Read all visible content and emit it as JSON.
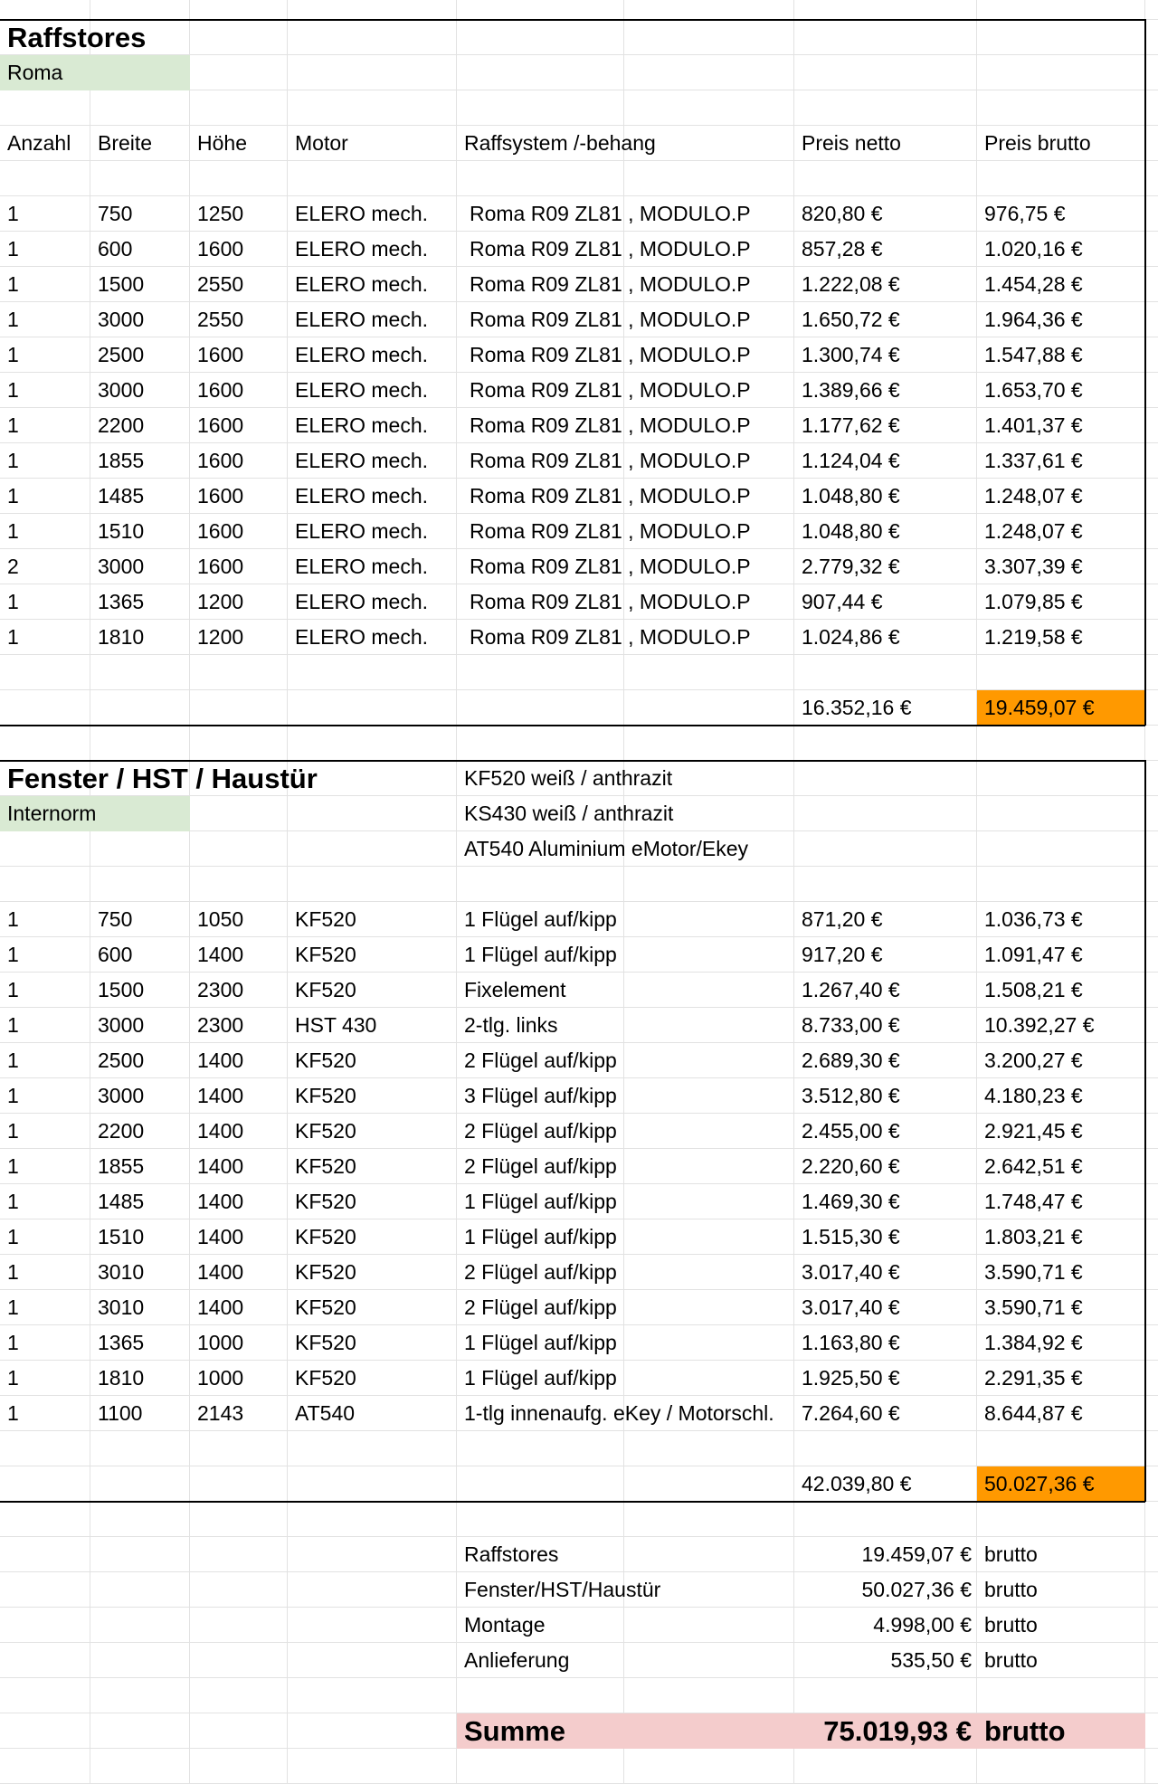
{
  "raff": {
    "title": "Raffstores",
    "subtitle": "Roma",
    "headers": [
      "Anzahl",
      "Breite",
      "Höhe",
      "Motor",
      "Raffsystem /-behang",
      "Preis netto",
      "Preis brutto"
    ],
    "rows": [
      [
        "1",
        "750",
        "1250",
        "ELERO mech.",
        "Roma R09 ZL81 , MODULO.P",
        "820,80 €",
        "976,75 €"
      ],
      [
        "1",
        "600",
        "1600",
        "ELERO mech.",
        "Roma R09 ZL81 , MODULO.P",
        "857,28 €",
        "1.020,16 €"
      ],
      [
        "1",
        "1500",
        "2550",
        "ELERO mech.",
        "Roma R09 ZL81 , MODULO.P",
        "1.222,08 €",
        "1.454,28 €"
      ],
      [
        "1",
        "3000",
        "2550",
        "ELERO mech.",
        "Roma R09 ZL81 , MODULO.P",
        "1.650,72 €",
        "1.964,36 €"
      ],
      [
        "1",
        "2500",
        "1600",
        "ELERO mech.",
        "Roma R09 ZL81 , MODULO.P",
        "1.300,74 €",
        "1.547,88 €"
      ],
      [
        "1",
        "3000",
        "1600",
        "ELERO mech.",
        "Roma R09 ZL81 , MODULO.P",
        "1.389,66 €",
        "1.653,70 €"
      ],
      [
        "1",
        "2200",
        "1600",
        "ELERO mech.",
        "Roma R09 ZL81 , MODULO.P",
        "1.177,62 €",
        "1.401,37 €"
      ],
      [
        "1",
        "1855",
        "1600",
        "ELERO mech.",
        "Roma R09 ZL81 , MODULO.P",
        "1.124,04 €",
        "1.337,61 €"
      ],
      [
        "1",
        "1485",
        "1600",
        "ELERO mech.",
        "Roma R09 ZL81 , MODULO.P",
        "1.048,80 €",
        "1.248,07 €"
      ],
      [
        "1",
        "1510",
        "1600",
        "ELERO mech.",
        "Roma R09 ZL81 , MODULO.P",
        "1.048,80 €",
        "1.248,07 €"
      ],
      [
        "2",
        "3000",
        "1600",
        "ELERO mech.",
        "Roma R09 ZL81 , MODULO.P",
        "2.779,32 €",
        "3.307,39 €"
      ],
      [
        "1",
        "1365",
        "1200",
        "ELERO mech.",
        "Roma R09 ZL81 , MODULO.P",
        "907,44 €",
        "1.079,85 €"
      ],
      [
        "1",
        "1810",
        "1200",
        "ELERO mech.",
        "Roma R09 ZL81 , MODULO.P",
        "1.024,86 €",
        "1.219,58 €"
      ]
    ],
    "total_netto": "16.352,16 €",
    "total_brutto": "19.459,07 €"
  },
  "fenster": {
    "title": "Fenster / HST / Haustür",
    "subtitle": "Internorm",
    "notes": [
      "KF520 weiß / anthrazit",
      "KS430 weiß / anthrazit",
      "AT540 Aluminium eMotor/Ekey"
    ],
    "rows": [
      [
        "1",
        "750",
        "1050",
        "KF520",
        "1 Flügel auf/kipp",
        "871,20 €",
        "1.036,73 €"
      ],
      [
        "1",
        "600",
        "1400",
        "KF520",
        "1 Flügel auf/kipp",
        "917,20 €",
        "1.091,47 €"
      ],
      [
        "1",
        "1500",
        "2300",
        "KF520",
        "Fixelement",
        "1.267,40 €",
        "1.508,21 €"
      ],
      [
        "1",
        "3000",
        "2300",
        "HST 430",
        "2-tlg. links",
        "8.733,00 €",
        "10.392,27 €"
      ],
      [
        "1",
        "2500",
        "1400",
        "KF520",
        "2 Flügel auf/kipp",
        "2.689,30 €",
        "3.200,27 €"
      ],
      [
        "1",
        "3000",
        "1400",
        "KF520",
        "3 Flügel auf/kipp",
        "3.512,80 €",
        "4.180,23 €"
      ],
      [
        "1",
        "2200",
        "1400",
        "KF520",
        "2 Flügel auf/kipp",
        "2.455,00 €",
        "2.921,45 €"
      ],
      [
        "1",
        "1855",
        "1400",
        "KF520",
        "2 Flügel auf/kipp",
        "2.220,60 €",
        "2.642,51 €"
      ],
      [
        "1",
        "1485",
        "1400",
        "KF520",
        "1 Flügel auf/kipp",
        "1.469,30 €",
        "1.748,47 €"
      ],
      [
        "1",
        "1510",
        "1400",
        "KF520",
        "1 Flügel auf/kipp",
        "1.515,30 €",
        "1.803,21 €"
      ],
      [
        "1",
        "3010",
        "1400",
        "KF520",
        "2 Flügel auf/kipp",
        "3.017,40 €",
        "3.590,71 €"
      ],
      [
        "1",
        "3010",
        "1400",
        "KF520",
        "2 Flügel auf/kipp",
        "3.017,40 €",
        "3.590,71 €"
      ],
      [
        "1",
        "1365",
        "1000",
        "KF520",
        "1 Flügel auf/kipp",
        "1.163,80 €",
        "1.384,92 €"
      ],
      [
        "1",
        "1810",
        "1000",
        "KF520",
        "1 Flügel auf/kipp",
        "1.925,50 €",
        "2.291,35 €"
      ],
      [
        "1",
        "1100",
        "2143",
        "AT540",
        "1-tlg innenaufg. eKey / Motorschl.",
        "7.264,60 €",
        "8.644,87 €"
      ]
    ],
    "total_netto": "42.039,80 €",
    "total_brutto": "50.027,36 €"
  },
  "summary": {
    "items": [
      {
        "label": "Raffstores",
        "value": "19.459,07 €",
        "unit": "brutto"
      },
      {
        "label": "Fenster/HST/Haustür",
        "value": "50.027,36 €",
        "unit": "brutto"
      },
      {
        "label": "Montage",
        "value": "4.998,00 €",
        "unit": "brutto"
      },
      {
        "label": "Anlieferung",
        "value": "535,50 €",
        "unit": "brutto"
      }
    ],
    "total_label": "Summe",
    "total_value": "75.019,93 €",
    "total_unit": "brutto"
  }
}
